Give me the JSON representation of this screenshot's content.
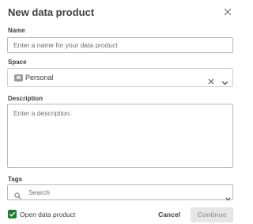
{
  "dialog": {
    "title": "New data product",
    "close_icon": "close-icon"
  },
  "name": {
    "label": "Name",
    "placeholder": "Enter a name for your data product",
    "value": ""
  },
  "space": {
    "label": "Space",
    "value": "Personal",
    "icon": "space-icon",
    "clear_icon": "clear-icon",
    "dropdown_icon": "chevron-down-icon"
  },
  "description": {
    "label": "Description",
    "placeholder": "Enter a description.",
    "value": ""
  },
  "tags": {
    "label": "Tags",
    "placeholder": "Search",
    "search_icon": "search-icon",
    "dropdown_icon": "chevron-down-icon"
  },
  "footer": {
    "open_checkbox_label": "Open data product",
    "open_checkbox_checked": true,
    "cancel_label": "Cancel",
    "continue_label": "Continue",
    "continue_enabled": false
  },
  "colors": {
    "checkbox_checked": "#1e7d30",
    "continue_disabled_bg": "#e6e6e6",
    "text": "#404040"
  }
}
